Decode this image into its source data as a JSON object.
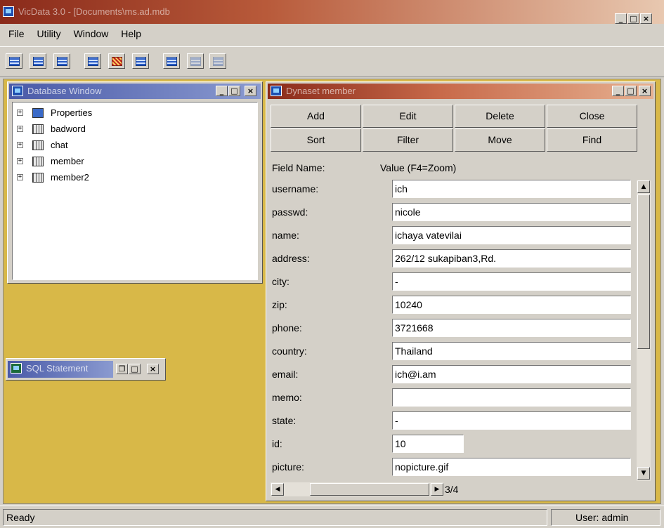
{
  "app": {
    "title": "VicData 3.0 - [Documents\\ms.ad.mdb",
    "menu": [
      "File",
      "Utility",
      "Window",
      "Help"
    ],
    "status_left": "Ready",
    "status_right": "User: admin"
  },
  "toolbar": {
    "buttons": [
      "table-view-icon",
      "form-view-icon",
      "query-icon",
      "report-icon",
      "chart-icon",
      "grid-icon",
      "sql-icon",
      "disabled-icon-1",
      "disabled-icon-2"
    ]
  },
  "database_window": {
    "title": "Database Window",
    "items": [
      {
        "label": "Properties",
        "icon": "properties-icon"
      },
      {
        "label": "badword",
        "icon": "table-icon"
      },
      {
        "label": "chat",
        "icon": "table-icon"
      },
      {
        "label": "member",
        "icon": "table-icon"
      },
      {
        "label": "member2",
        "icon": "table-icon"
      }
    ]
  },
  "sql_window": {
    "title": "SQL Statement"
  },
  "record_window": {
    "title": "Dynaset member",
    "buttons": [
      "Add",
      "Edit",
      "Delete",
      "Close",
      "Sort",
      "Filter",
      "Move",
      "Find"
    ],
    "header_field": "Field Name:",
    "header_value": "Value (F4=Zoom)",
    "fields": [
      {
        "name": "username:",
        "value": "ich"
      },
      {
        "name": "passwd:",
        "value": "nicole"
      },
      {
        "name": "name:",
        "value": "ichaya vatevilai"
      },
      {
        "name": "address:",
        "value": "262/12 sukapiban3,Rd."
      },
      {
        "name": "city:",
        "value": "-"
      },
      {
        "name": "zip:",
        "value": "10240"
      },
      {
        "name": "phone:",
        "value": "3721668"
      },
      {
        "name": "country:",
        "value": "Thailand"
      },
      {
        "name": "email:",
        "value": "ich@i.am"
      },
      {
        "name": "memo:",
        "value": ""
      },
      {
        "name": "state:",
        "value": "-"
      },
      {
        "name": "id:",
        "value": "10"
      },
      {
        "name": "picture:",
        "value": "nopicture.gif"
      }
    ],
    "record_position": "3/4"
  },
  "colors": {
    "title_active_start": "#8a2a1a",
    "title_active_end": "#e8c8b0",
    "title_inactive": "#5a6ab8",
    "mdi_background": "#d8b848"
  }
}
